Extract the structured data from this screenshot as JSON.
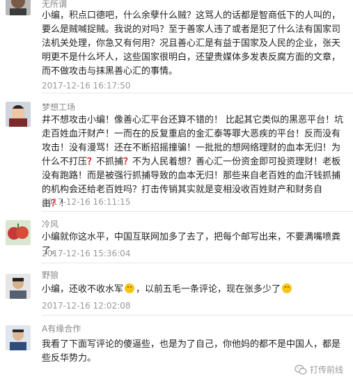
{
  "comments": [
    {
      "username": "无所谓",
      "content": "小编，积点口德吧，什么余孽什么贼？这骂人的话都是智商低下的人叫的，要么是贼喊捉贼。我说的对吗？至于善家人违了或者是犯了什么法有国家司法机关处理，你急又有何用？况且善心汇是有益于国家及人民的企业，张天明更不是什么坏人，这些国家很明白，还望贵媒体多发表反腐方面的文章，而不做攻击与抹黑善心汇的事情。",
      "time": "2017-12-16 16:17:50"
    },
    {
      "username": "梦想工场",
      "content_parts": [
        "井不想攻击小编！像善心汇平台还算不错的！ 比起其它类似的黑恶平台！坑走百姓血汗财产！一而在的反复重启的金汇泰等罪大恶疾的平台！反而没有攻击！没有漫骂！还在不断招摇撞骗！一批批的想网络理财的血本无归！为什么不打压",
        "？",
        "不抓捕",
        "？",
        "不为人民着想？善心汇一份资金即可投资理财！老板没有跑路！而是被强行抓捕导致的血本无归！那些来自老百姓的血汗钱抓捕的机构会还给老百姓吗？打击传销其实就是变相没收百姓财产和财务自由",
        "？",
        "！"
      ],
      "time": "2017-12-16 16:11:15"
    },
    {
      "username": "冷风",
      "content": "小编就你这水平，中国互联网加多了去了，把每个邮写出来，不要满嘴喷粪了。",
      "time": "2017-12-16 15:36:04"
    },
    {
      "username": "野狼",
      "content_before": "小编，还收不收水军",
      "content_middle": "，以前五毛一条评论，现在张多少了",
      "time": "2017-12-16 12:02:08"
    },
    {
      "username": "A有缘合作",
      "content": "我看了下面写评论的傻逼些，也是为了自己，你他妈的都不是中国人，都是些反华势力。"
    }
  ],
  "watermark": {
    "text": "打传前线",
    "icon": "wechat-logo-icon"
  },
  "colors": {
    "username": "#888888",
    "time": "#999999",
    "text": "#222222",
    "accent_question": "#e02020"
  }
}
